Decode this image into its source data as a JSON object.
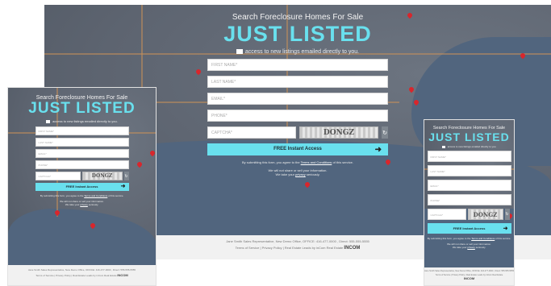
{
  "subhead": "Search Foreclosure Homes For Sale",
  "headline": "JUST LISTED",
  "tagline": "access to new listings emailed directly to you.",
  "fields": {
    "first_name": "FIRST NAME*",
    "last_name": "LAST NAME*",
    "email": "EMAIL*",
    "phone": "PHONE*",
    "captcha": "CAPTCHA*"
  },
  "captcha_text": "DONGZ",
  "submit_label": "FREE Instant Access",
  "consent_prefix": "By submitting this form, you agree to the",
  "consent_link": "Terms and Conditions",
  "consent_suffix": "of this service.",
  "privacy_line1": "We will not share or sell your information.",
  "privacy_line2_prefix": "We take your",
  "privacy_link": "privacy",
  "privacy_line2_suffix": "seriously.",
  "footer": {
    "agent_line": "Jane Smith Sales Representative, New Demo Office, OFFICE: 416-477-0000 , Direct: 555-555-5555",
    "links_line": "Terms of Service | Privacy Policy | Real Estate Leads by inCom Real Estate",
    "logo": "INCOM"
  },
  "colors": {
    "accent": "#69e0ee",
    "map": "#5d6470",
    "pin": "#d8262c"
  }
}
